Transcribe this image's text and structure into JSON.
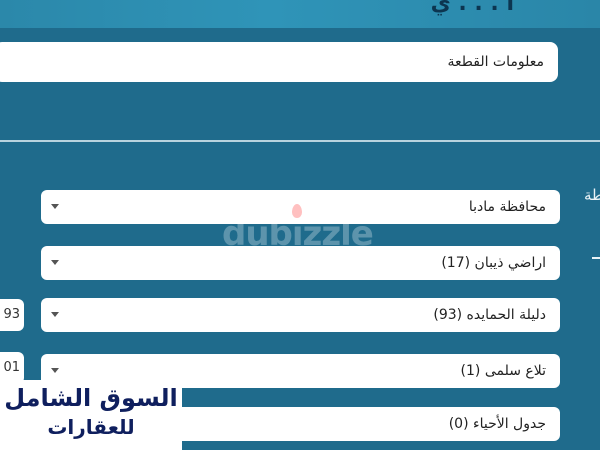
{
  "header": {
    "title": "أ . . . ي"
  },
  "plot_info": {
    "value": "معلومات القطعة"
  },
  "side_label": "طة",
  "selects": [
    {
      "value": "محافظة مادبا"
    },
    {
      "value": "اراضي ذيبان (17)"
    },
    {
      "value": "دليلة الحمايده (93)"
    },
    {
      "value": "تلاع سلمى (1)"
    },
    {
      "value": "جدول الأحياء (0)"
    }
  ],
  "side_inputs": [
    {
      "value": "93"
    },
    {
      "value": "01"
    }
  ],
  "watermark": {
    "text": "dubizzle"
  },
  "logo": {
    "line1": "السوق الشامل",
    "line2": "للعقارات"
  },
  "colors": {
    "background": "#1f6b8c",
    "logo_text": "#0f1f5e"
  }
}
